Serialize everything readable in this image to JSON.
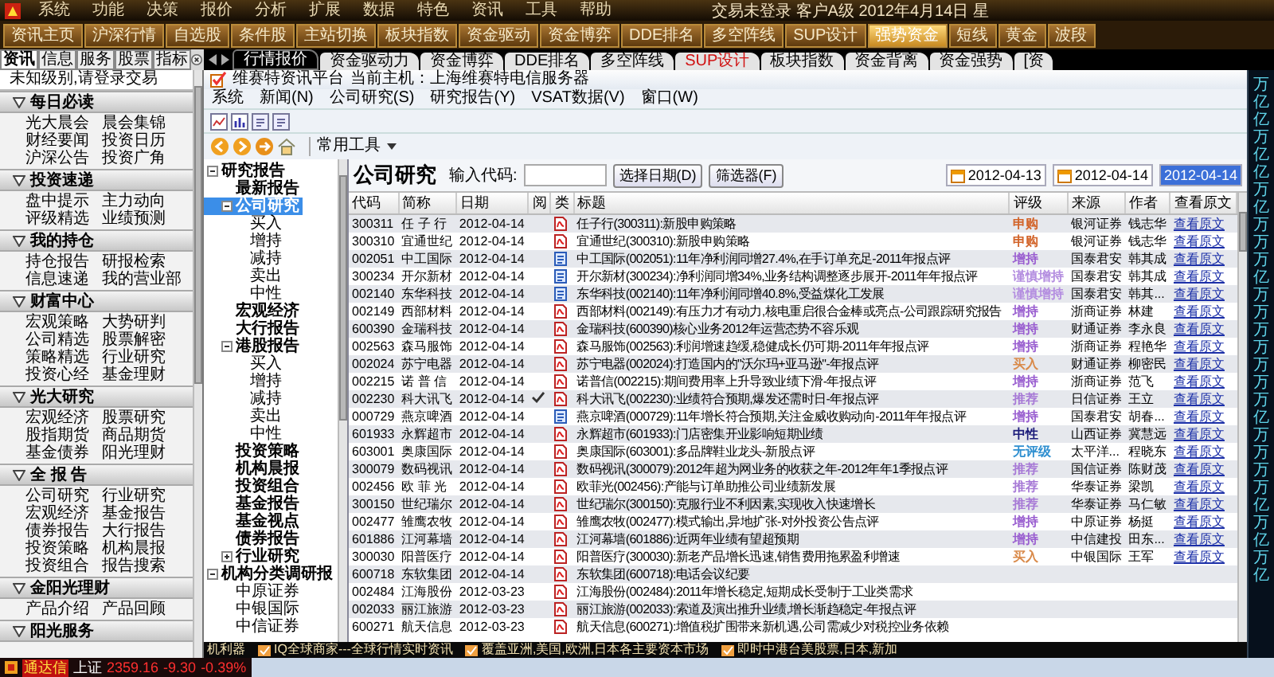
{
  "menu_bar": {
    "items": [
      "系统",
      "功能",
      "决策",
      "报价",
      "分析",
      "扩展",
      "数据",
      "特色",
      "资讯",
      "工具",
      "帮助"
    ],
    "status": "交易未登录  客户A级  2012年4月14日 星"
  },
  "toolbar": {
    "buttons": [
      {
        "label": "资讯主页",
        "selected": false
      },
      {
        "label": "沪深行情",
        "selected": false
      },
      {
        "label": "自选股",
        "selected": false
      },
      {
        "label": "条件股",
        "selected": false
      },
      {
        "label": "主站切换",
        "selected": false
      },
      {
        "label": "板块指数",
        "selected": false
      },
      {
        "label": "资金驱动",
        "selected": false
      },
      {
        "label": "资金博弈",
        "selected": false
      },
      {
        "label": "DDE排名",
        "selected": false
      },
      {
        "label": "多空阵线",
        "selected": false
      },
      {
        "label": "SUP设计",
        "selected": false
      },
      {
        "label": "强势资金",
        "selected": true
      },
      {
        "label": "短线",
        "selected": false
      },
      {
        "label": "黄金",
        "selected": false
      },
      {
        "label": "波段",
        "selected": false
      }
    ]
  },
  "left_tabs": [
    {
      "label": "资讯",
      "selected": true
    },
    {
      "label": "信息",
      "selected": false
    },
    {
      "label": "服务",
      "selected": false
    },
    {
      "label": "股票",
      "selected": false
    },
    {
      "label": "指标",
      "selected": false
    }
  ],
  "view_tabs": [
    {
      "label": "行情报价",
      "selected": true,
      "highlight": false
    },
    {
      "label": "资金驱动力",
      "selected": false,
      "highlight": false
    },
    {
      "label": "资金博弈",
      "selected": false,
      "highlight": false
    },
    {
      "label": "DDE排名",
      "selected": false,
      "highlight": false
    },
    {
      "label": "多空阵线",
      "selected": false,
      "highlight": false
    },
    {
      "label": "SUP设计",
      "selected": false,
      "highlight": true
    },
    {
      "label": "板块指数",
      "selected": false,
      "highlight": false
    },
    {
      "label": "资金背离",
      "selected": false,
      "highlight": false
    },
    {
      "label": "资金强势",
      "selected": false,
      "highlight": false
    },
    {
      "label": "[资",
      "selected": false,
      "highlight": false
    }
  ],
  "sidebar": {
    "notice": "未知级别,请登录交易",
    "groups": [
      {
        "title": "每日必读",
        "expanded": true,
        "items": [
          "光大晨会",
          "晨会集锦",
          "财经要闻",
          "投资日历",
          "沪深公告",
          "投资广角"
        ]
      },
      {
        "title": "投资速递",
        "expanded": true,
        "items": [
          "盘中提示",
          "主力动向",
          "评级精选",
          "业绩预测"
        ]
      },
      {
        "title": "我的持仓",
        "expanded": true,
        "items": [
          "持仓报告",
          "研报检索",
          "信息速递",
          "我的营业部"
        ]
      },
      {
        "title": "财富中心",
        "expanded": true,
        "items": [
          "宏观策略",
          "大势研判",
          "公司精选",
          "股票解密",
          "策略精选",
          "行业研究",
          "投资心经",
          "基金理财"
        ]
      },
      {
        "title": "光大研究",
        "expanded": true,
        "items": [
          "宏观经济",
          "股票研究",
          "股指期货",
          "商品期货",
          "基金债券",
          "阳光理财"
        ]
      },
      {
        "title": "全 报 告",
        "expanded": true,
        "items": [
          "公司研究",
          "行业研究",
          "宏观经济",
          "基金报告",
          "债券报告",
          "大行报告",
          "投资策略",
          "机构晨报",
          "投资组合",
          "报告搜索"
        ]
      },
      {
        "title": "金阳光理财",
        "expanded": true,
        "items": [
          "产品介绍",
          "产品回顾"
        ]
      },
      {
        "title": "阳光服务",
        "expanded": true
      }
    ]
  },
  "window": {
    "title": "维赛特资讯平台",
    "host": "当前主机：上海维赛特电信服务器",
    "menu": [
      "系统",
      "新闻(N)",
      "公司研究(S)",
      "研究报告(Y)",
      "VSAT数据(V)",
      "窗口(W)"
    ],
    "tools": "常用工具"
  },
  "tree": [
    {
      "label": "研究报告",
      "kind": "group",
      "selected": false,
      "expanded": true,
      "children": [
        {
          "label": "最新报告",
          "kind": "group",
          "selected": false
        },
        {
          "label": "公司研究",
          "kind": "group",
          "selected": true,
          "expanded": true,
          "children": [
            {
              "label": "买入",
              "kind": "leaf",
              "selected": false
            },
            {
              "label": "增持",
              "kind": "leaf",
              "selected": false
            },
            {
              "label": "减持",
              "kind": "leaf",
              "selected": false
            },
            {
              "label": "卖出",
              "kind": "leaf",
              "selected": false
            },
            {
              "label": "中性",
              "kind": "leaf",
              "selected": false
            }
          ]
        },
        {
          "label": "宏观经济",
          "kind": "group",
          "selected": false
        },
        {
          "label": "大行报告",
          "kind": "group",
          "selected": false
        },
        {
          "label": "港股报告",
          "kind": "group",
          "selected": false,
          "expanded": true,
          "children": [
            {
              "label": "买入",
              "kind": "leaf",
              "selected": false
            },
            {
              "label": "增持",
              "kind": "leaf",
              "selected": false
            },
            {
              "label": "减持",
              "kind": "leaf",
              "selected": false
            },
            {
              "label": "卖出",
              "kind": "leaf",
              "selected": false
            },
            {
              "label": "中性",
              "kind": "leaf",
              "selected": false
            }
          ]
        },
        {
          "label": "投资策略",
          "kind": "group",
          "selected": false
        },
        {
          "label": "机构晨报",
          "kind": "group",
          "selected": false
        },
        {
          "label": "投资组合",
          "kind": "group",
          "selected": false
        },
        {
          "label": "基金报告",
          "kind": "group",
          "selected": false
        },
        {
          "label": "基金视点",
          "kind": "group",
          "selected": false
        },
        {
          "label": "债券报告",
          "kind": "group",
          "selected": false
        },
        {
          "label": "行业研究",
          "kind": "group",
          "selected": false,
          "expanded": false
        }
      ]
    },
    {
      "label": "机构分类调研报",
      "kind": "group",
      "selected": false,
      "expanded": true,
      "children": [
        {
          "label": "中原证券",
          "kind": "leaf",
          "selected": false
        },
        {
          "label": "中银国际",
          "kind": "leaf",
          "selected": false
        },
        {
          "label": "中信证券",
          "kind": "leaf",
          "selected": false
        }
      ]
    }
  ],
  "report": {
    "heading": "公司研究",
    "code_label": "输入代码:",
    "buttons": [
      "选择日期(D)",
      "筛选器(F)"
    ],
    "dates": [
      {
        "text": "2012-04-13",
        "selected": false
      },
      {
        "text": "2012-04-14",
        "selected": false
      },
      {
        "text": "2012-04-14",
        "selected": true
      }
    ],
    "columns": [
      "代码",
      "简称",
      "日期",
      "阅",
      "类",
      "标题",
      "评级",
      "来源",
      "作者",
      "查看原文"
    ],
    "rows": [
      {
        "code": "300311",
        "name": "任 子 行",
        "date": "2012-04-14",
        "read": false,
        "kind": "pdf",
        "title": "任子行(300311):新股申购策略",
        "rating": {
          "text": "申购",
          "color": "#d2642a"
        },
        "source": "银河证券",
        "author": "钱志华",
        "link": "查看原文"
      },
      {
        "code": "300310",
        "name": "宜通世纪",
        "date": "2012-04-14",
        "read": false,
        "kind": "pdf",
        "title": "宜通世纪(300310):新股申购策略",
        "rating": {
          "text": "申购",
          "color": "#d2642a"
        },
        "source": "银河证券",
        "author": "钱志华",
        "link": "查看原文"
      },
      {
        "code": "002051",
        "name": "中工国际",
        "date": "2012-04-14",
        "read": false,
        "kind": "doc",
        "title": "中工国际(002051):11年净利润同增27.4%,在手订单充足-2011年报点评",
        "rating": {
          "text": "增持",
          "color": "#9a5fd0"
        },
        "source": "国泰君安",
        "author": "韩其成",
        "link": "查看原文"
      },
      {
        "code": "300234",
        "name": "开尔新材",
        "date": "2012-04-14",
        "read": false,
        "kind": "doc",
        "title": "开尔新材(300234):净利润同增34%,业务结构调整逐步展开-2011年年报点评",
        "rating": {
          "text": "谨慎增持",
          "color": "#b48ee0"
        },
        "source": "国泰君安",
        "author": "韩其成",
        "link": "查看原文"
      },
      {
        "code": "002140",
        "name": "东华科技",
        "date": "2012-04-14",
        "read": false,
        "kind": "doc",
        "title": "东华科技(002140):11年净利润同增40.8%,受益煤化工发展",
        "rating": {
          "text": "谨慎增持",
          "color": "#b48ee0"
        },
        "source": "国泰君安",
        "author": "韩其...",
        "link": "查看原文"
      },
      {
        "code": "002149",
        "name": "西部材料",
        "date": "2012-04-14",
        "read": false,
        "kind": "pdf",
        "title": "西部材料(002149):有压力才有动力,核电重启很合金棒或亮点-公司跟踪研究报告",
        "rating": {
          "text": "增持",
          "color": "#9a5fd0"
        },
        "source": "浙商证券",
        "author": "林建",
        "link": "查看原文"
      },
      {
        "code": "600390",
        "name": "金瑞科技",
        "date": "2012-04-14",
        "read": false,
        "kind": "pdf",
        "title": "金瑞科技(600390)核心业务2012年运营态势不容乐观",
        "rating": {
          "text": "增持",
          "color": "#9a5fd0"
        },
        "source": "财通证券",
        "author": "李永良",
        "link": "查看原文"
      },
      {
        "code": "002563",
        "name": "森马服饰",
        "date": "2012-04-14",
        "read": false,
        "kind": "pdf",
        "title": "森马服饰(002563):利润增速趋缓,稳健成长仍可期-2011年年报点评",
        "rating": {
          "text": "增持",
          "color": "#9a5fd0"
        },
        "source": "浙商证券",
        "author": "程艳华",
        "link": "查看原文"
      },
      {
        "code": "002024",
        "name": "苏宁电器",
        "date": "2012-04-14",
        "read": false,
        "kind": "pdf",
        "title": "苏宁电器(002024):打造国内的\"沃尔玛+亚马逊\"-年报点评",
        "rating": {
          "text": "买入",
          "color": "#d98a4a"
        },
        "source": "财通证券",
        "author": "柳密民",
        "link": "查看原文"
      },
      {
        "code": "002215",
        "name": "诺 普 信",
        "date": "2012-04-14",
        "read": false,
        "kind": "pdf",
        "title": "诺普信(002215):期间费用率上升导致业绩下滑-年报点评",
        "rating": {
          "text": "增持",
          "color": "#9a5fd0"
        },
        "source": "浙商证券",
        "author": "范飞",
        "link": "查看原文"
      },
      {
        "code": "002230",
        "name": "科大讯飞",
        "date": "2012-04-14",
        "read": true,
        "kind": "pdf",
        "title": "科大讯飞(002230):业绩符合预期,爆发还需时日-年报点评",
        "rating": {
          "text": "推荐",
          "color": "#a77ad6"
        },
        "source": "日信证券",
        "author": "王立",
        "link": "查看原文"
      },
      {
        "code": "000729",
        "name": "燕京啤酒",
        "date": "2012-04-14",
        "read": false,
        "kind": "doc",
        "title": "燕京啤酒(000729):11年增长符合预期,关注金威收购动向-2011年年报点评",
        "rating": {
          "text": "增持",
          "color": "#9a5fd0"
        },
        "source": "国泰君安",
        "author": "胡春...",
        "link": "查看原文"
      },
      {
        "code": "601933",
        "name": "永辉超市",
        "date": "2012-04-14",
        "read": false,
        "kind": "pdf",
        "title": "永辉超市(601933):门店密集开业影响短期业绩",
        "rating": {
          "text": "中性",
          "color": "#1c1c7a"
        },
        "source": "山西证券",
        "author": "冀慧远",
        "link": "查看原文"
      },
      {
        "code": "603001",
        "name": "奥康国际",
        "date": "2012-04-14",
        "read": false,
        "kind": "pdf",
        "title": "奥康国际(603001):多品牌鞋业龙头-新股点评",
        "rating": {
          "text": "无评级",
          "color": "#2f8fd0"
        },
        "source": "太平洋...",
        "author": "程晓东",
        "link": "查看原文"
      },
      {
        "code": "300079",
        "name": "数码视讯",
        "date": "2012-04-14",
        "read": false,
        "kind": "pdf",
        "title": "数码视讯(300079):2012年超为网业务的收获之年-2012年年1季报点评",
        "rating": {
          "text": "推荐",
          "color": "#a77ad6"
        },
        "source": "国信证券",
        "author": "陈财茂",
        "link": "查看原文"
      },
      {
        "code": "002456",
        "name": "欧 菲 光",
        "date": "2012-04-14",
        "read": false,
        "kind": "pdf",
        "title": "欧菲光(002456):产能与订单助推公司业绩新发展",
        "rating": {
          "text": "推荐",
          "color": "#a77ad6"
        },
        "source": "华泰证券",
        "author": "梁凯",
        "link": "查看原文"
      },
      {
        "code": "300150",
        "name": "世纪瑞尔",
        "date": "2012-04-14",
        "read": false,
        "kind": "pdf",
        "title": "世纪瑞尔(300150):克服行业不利因素,实现收入快速增长",
        "rating": {
          "text": "推荐",
          "color": "#a77ad6"
        },
        "source": "华泰证券",
        "author": "马仁敏",
        "link": "查看原文"
      },
      {
        "code": "002477",
        "name": "雏鹰农牧",
        "date": "2012-04-14",
        "read": false,
        "kind": "pdf",
        "title": "雏鹰农牧(002477):模式输出,异地扩张-对外投资公告点评",
        "rating": {
          "text": "增持",
          "color": "#9a5fd0"
        },
        "source": "中原证券",
        "author": "杨挺",
        "link": "查看原文"
      },
      {
        "code": "601886",
        "name": "江河幕墙",
        "date": "2012-04-14",
        "read": false,
        "kind": "pdf",
        "title": "江河幕墙(601886):近两年业绩有望超预期",
        "rating": {
          "text": "增持",
          "color": "#9a5fd0"
        },
        "source": "中信建投",
        "author": "田东...",
        "link": "查看原文"
      },
      {
        "code": "300030",
        "name": "阳普医疗",
        "date": "2012-04-14",
        "read": false,
        "kind": "pdf",
        "title": "阳普医疗(300030):新老产品增长迅速,销售费用拖累盈利增速",
        "rating": {
          "text": "买入",
          "color": "#d98a4a"
        },
        "source": "中银国际",
        "author": "王军",
        "link": "查看原文"
      },
      {
        "code": "600718",
        "name": "东软集团",
        "date": "2012-04-14",
        "read": false,
        "kind": "pdf",
        "title": "东软集团(600718):电话会议纪要"
      },
      {
        "code": "002484",
        "name": "江海股份",
        "date": "2012-03-23",
        "read": false,
        "kind": "pdf",
        "title": "江海股份(002484):2011年增长稳定,短期成长受制于工业类需求"
      },
      {
        "code": "002033",
        "name": "丽江旅游",
        "date": "2012-03-23",
        "read": false,
        "kind": "pdf",
        "title": "丽江旅游(002033):索道及演出推升业绩,增长渐趋稳定-年报点评"
      },
      {
        "code": "600271",
        "name": "航天信息",
        "date": "2012-03-23",
        "read": false,
        "kind": "pdf",
        "title": "航天信息(600271):增值税扩围带来新机遇,公司需减少对税控业务依赖"
      }
    ]
  },
  "unit_strip": [
    "万",
    "亿",
    "亿",
    "万",
    "亿",
    "亿",
    "万",
    "亿",
    "万",
    "万",
    "万",
    "亿",
    "万",
    "万",
    "万",
    "万",
    "万",
    "万",
    "万",
    "亿",
    "万",
    "万",
    "万",
    "万",
    "亿",
    "万",
    "亿",
    "万",
    "亿"
  ],
  "ticker": {
    "lead": "机利器",
    "items": [
      "IQ全球商家---全球行情实时资讯",
      "覆盖亚洲,美国,欧洲,日本各主要资本市场",
      "即时中港台美股票,日本,新加"
    ]
  },
  "status_bar": {
    "app": "通达信",
    "index": "上证",
    "value": "2359.16",
    "change": "-9.30",
    "percent": "-0.39%"
  }
}
